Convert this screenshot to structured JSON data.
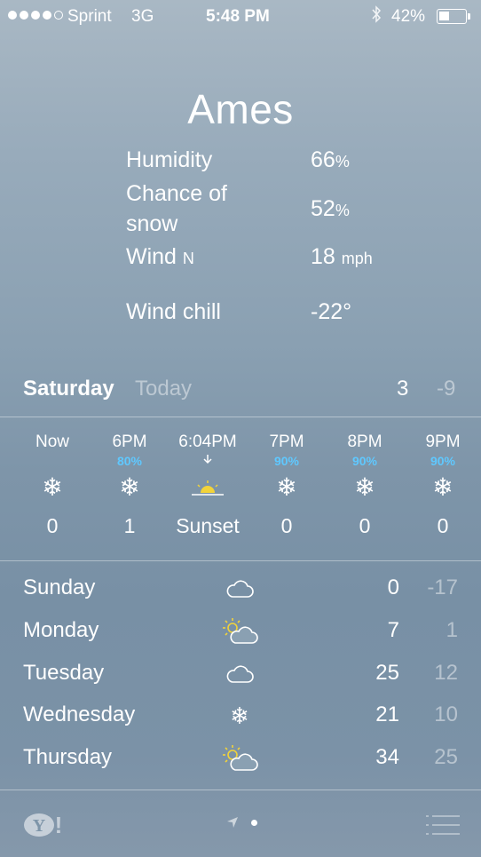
{
  "status_bar": {
    "carrier": "Sprint",
    "network": "3G",
    "time": "5:48 PM",
    "battery_percent": "42%",
    "battery_level": 0.42,
    "signal_bars_filled": 4,
    "signal_bars_total": 5
  },
  "city": "Ames",
  "details": {
    "humidity_label": "Humidity",
    "humidity_value": "66",
    "humidity_unit": "%",
    "snow_label_line1": "Chance of",
    "snow_label_line2": "snow",
    "snow_value": "52",
    "snow_unit": "%",
    "wind_label": "Wind",
    "wind_dir": "N",
    "wind_value": "18",
    "wind_unit": "mph",
    "windchill_label": "Wind chill",
    "windchill_value": "-22°"
  },
  "today": {
    "day": "Saturday",
    "label": "Today",
    "high": "3",
    "low": "-9"
  },
  "hourly": [
    {
      "time": "Now",
      "pct": "",
      "icon": "snowflake-icon",
      "temp": "0"
    },
    {
      "time": "6PM",
      "pct": "80%",
      "icon": "snowflake-icon",
      "temp": "1"
    },
    {
      "time": "6:04PM",
      "pct": "",
      "icon": "sunset-icon",
      "temp": "Sunset"
    },
    {
      "time": "7PM",
      "pct": "90%",
      "icon": "snowflake-icon",
      "temp": "0"
    },
    {
      "time": "8PM",
      "pct": "90%",
      "icon": "snowflake-icon",
      "temp": "0"
    },
    {
      "time": "9PM",
      "pct": "90%",
      "icon": "snowflake-icon",
      "temp": "0"
    }
  ],
  "daily": [
    {
      "day": "Sunday",
      "icon": "cloud-icon",
      "high": "0",
      "low": "-17"
    },
    {
      "day": "Monday",
      "icon": "partly-sunny-icon",
      "high": "7",
      "low": "1"
    },
    {
      "day": "Tuesday",
      "icon": "cloud-icon",
      "high": "25",
      "low": "12"
    },
    {
      "day": "Wednesday",
      "icon": "snowflake-icon",
      "high": "21",
      "low": "10"
    },
    {
      "day": "Thursday",
      "icon": "partly-sunny-icon",
      "high": "34",
      "low": "25"
    }
  ],
  "colors": {
    "precip_blue": "#5fc8ff",
    "sun_yellow": "#f2d33a"
  }
}
